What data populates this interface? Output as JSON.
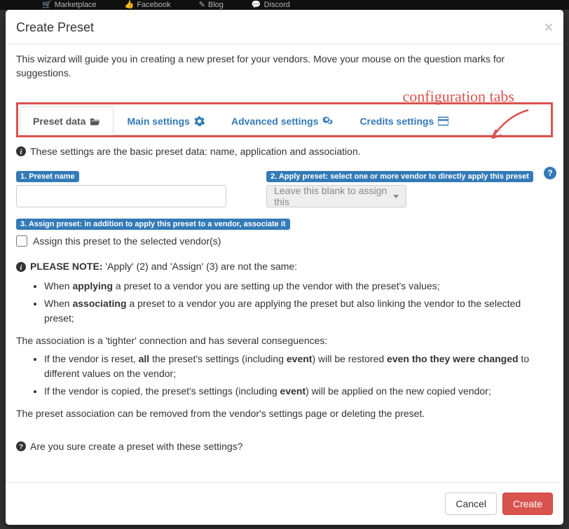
{
  "nav": {
    "item0": "Marketplace",
    "item1": "Facebook",
    "item2": "Blog",
    "item3": "Discord"
  },
  "modal": {
    "title": "Create Preset",
    "intro": "This wizard will guide you in creating a new preset for your vendors. Move your mouse on the question marks for suggestions.",
    "close": "×"
  },
  "annotation": {
    "label": "configuration tabs"
  },
  "tabs": {
    "t0": "Preset data",
    "t1": "Main settings",
    "t2": "Advanced settings",
    "t3": "Credits settings"
  },
  "section_note": "These settings are the basic preset data: name, application and association.",
  "field": {
    "name_label": "1. Preset name",
    "apply_label": "2. Apply preset: select one or more vendor to directly apply this preset",
    "apply_placeholder": "Leave this blank to assign this",
    "assign_label": "3. Assign preset: in addition to apply this preset to a vendor, associate it",
    "assign_checkbox": "Assign this preset to the selected vendor(s)",
    "help": "?"
  },
  "note": {
    "lead": "PLEASE NOTE:",
    "lead_rest": " 'Apply' (2) and 'Assign' (3) are not the same:",
    "li1a": "When ",
    "li1b": "applying",
    "li1c": " a preset to a vendor you are setting up the vendor with the preset's values;",
    "li2a": "When ",
    "li2b": "associating",
    "li2c": " a preset to a vendor you are applying the preset but also linking the vendor to the selected preset;",
    "p2": "The association is a 'tighter' connection and has several conseguences:",
    "li3a": "If the vendor is reset, ",
    "li3b": "all",
    "li3c": " the preset's settings (including ",
    "li3d": "event",
    "li3e": ") will be restored ",
    "li3f": "even tho they were changed",
    "li3g": " to different values on the vendor;",
    "li4a": "If the vendor is copied, the preset's settings (including ",
    "li4b": "event",
    "li4c": ") will be applied on the new copied vendor;",
    "p3": "The preset association can be removed from the vendor's settings page or deleting the preset."
  },
  "confirm": "Are you sure create a preset with these settings?",
  "footer": {
    "cancel": "Cancel",
    "create": "Create"
  }
}
